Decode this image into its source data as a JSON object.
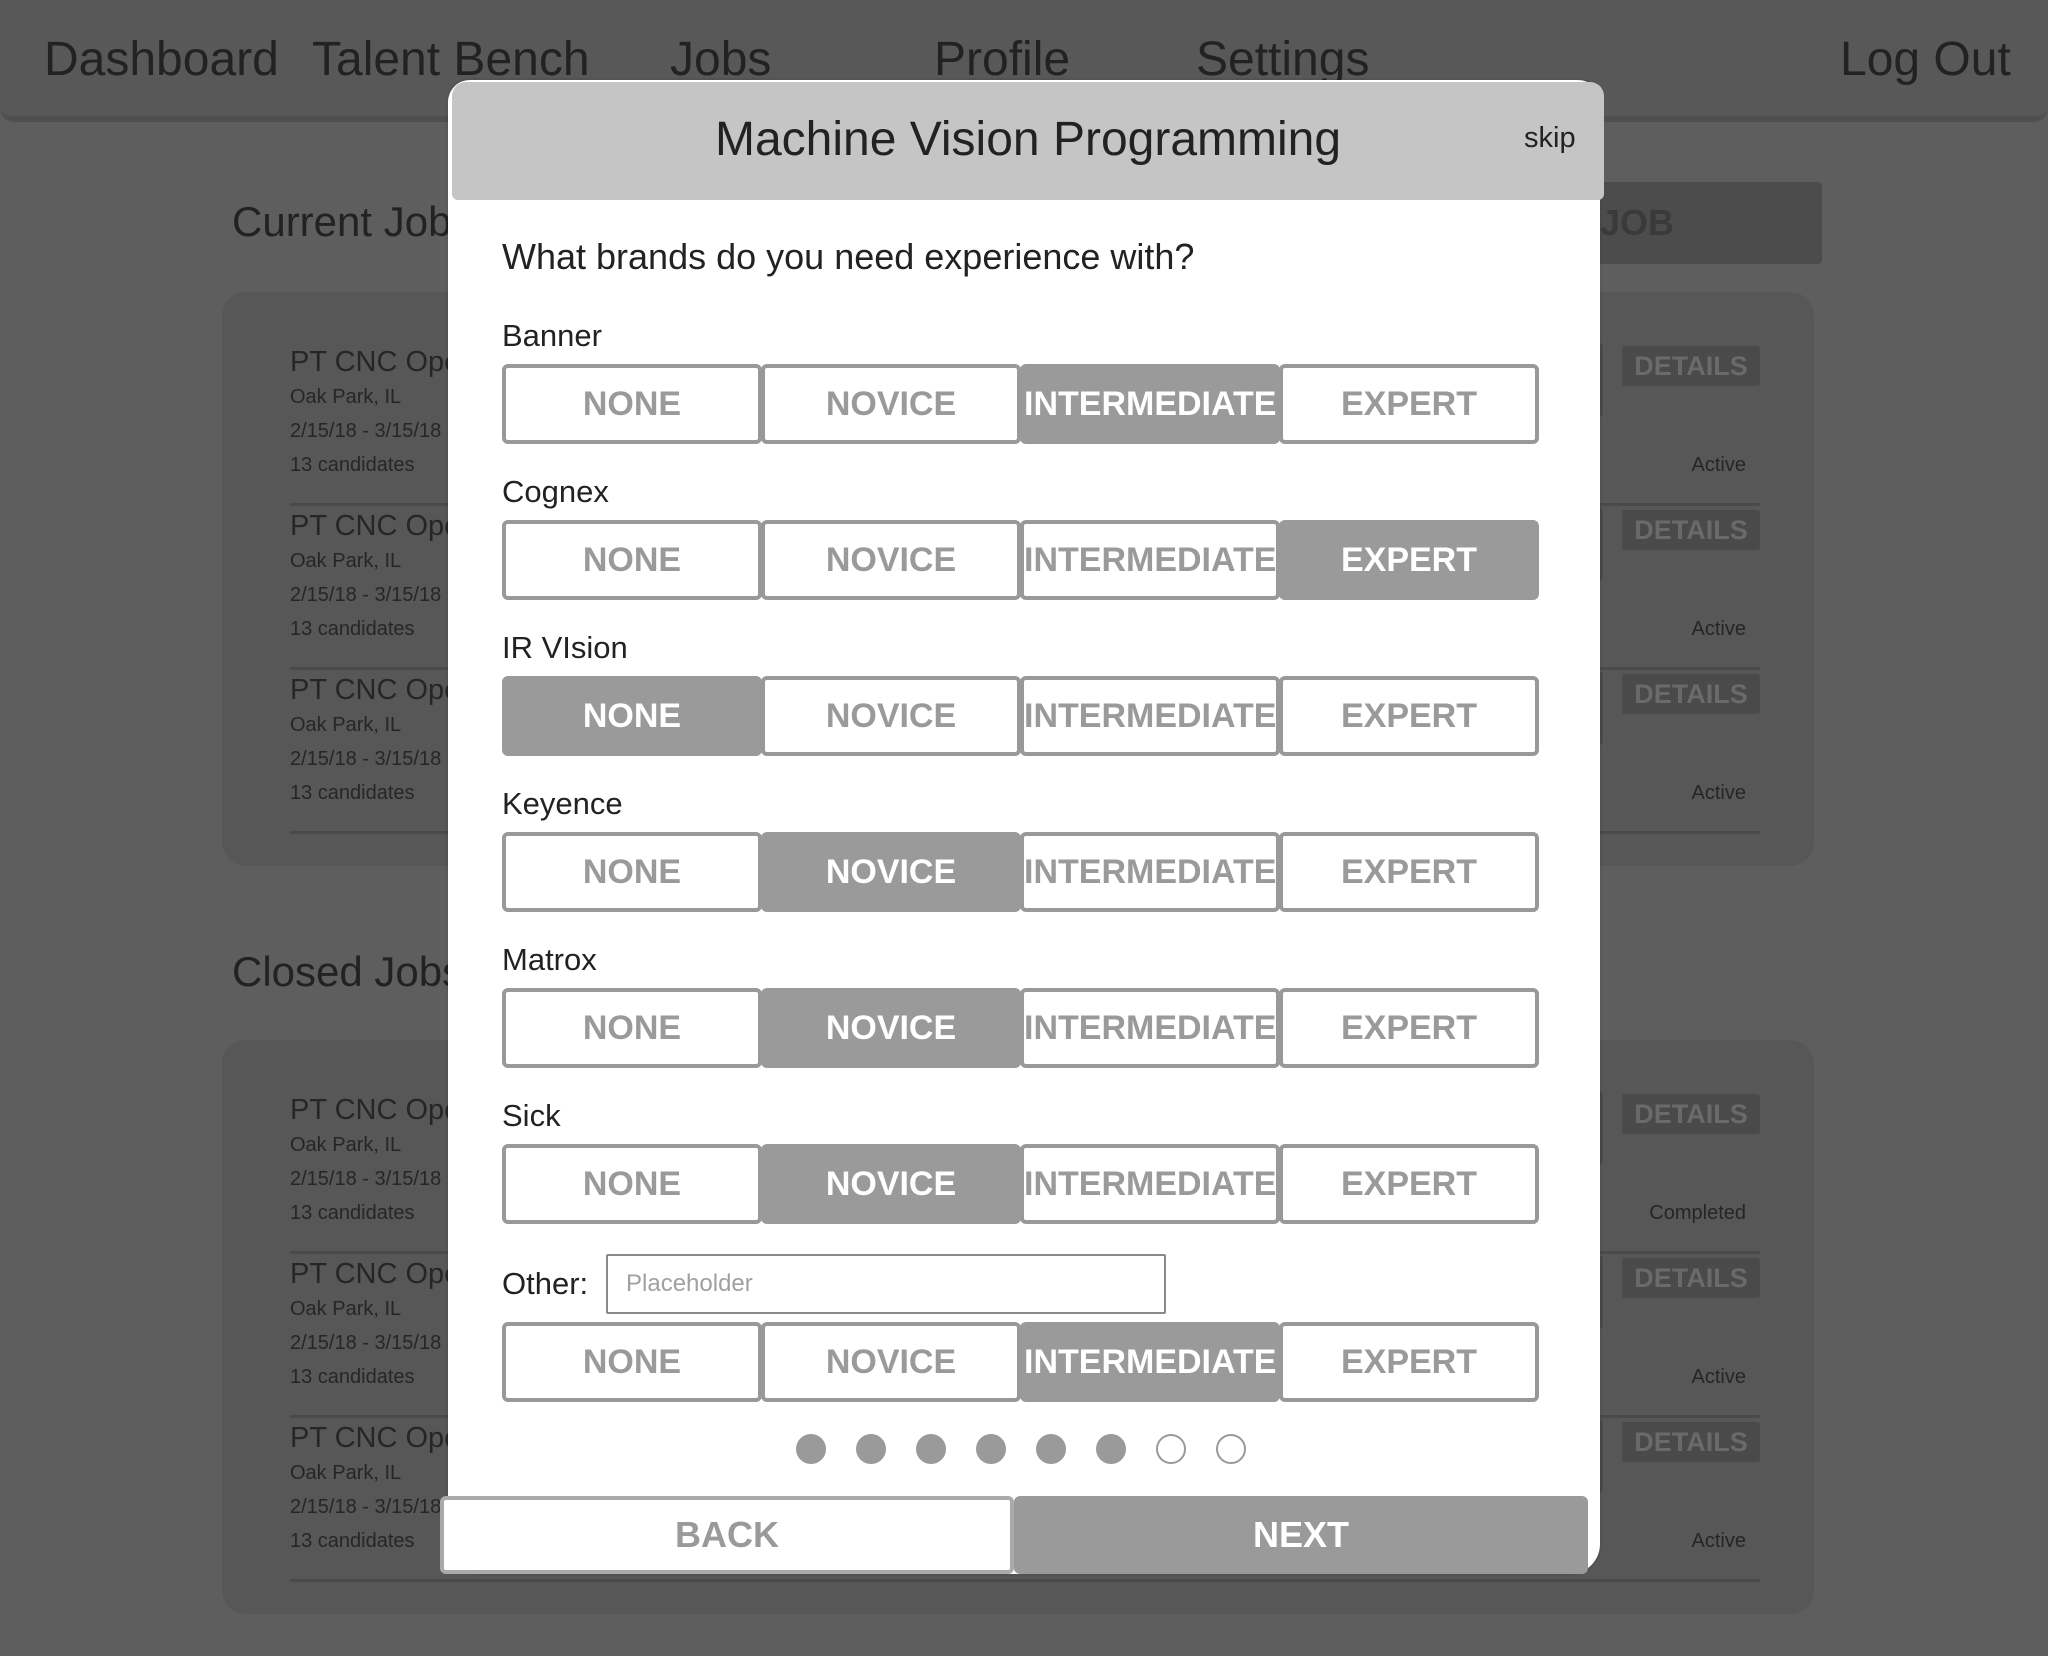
{
  "nav": {
    "dashboard": "Dashboard",
    "talent_bench": "Talent Bench",
    "jobs": "Jobs",
    "profile": "Profile",
    "settings": "Settings",
    "logout": "Log Out"
  },
  "background": {
    "current_jobs_title": "Current Jobs",
    "closed_jobs_title": "Closed Jobs",
    "new_job_label": "JOB",
    "details_label": "DETAILS",
    "current_jobs": [
      {
        "title": "PT CNC Operator",
        "location": "Oak Park, IL",
        "dates": "2/15/18 - 3/15/18",
        "candidates": "13 candidates",
        "status": "Active"
      },
      {
        "title": "PT CNC Operator",
        "location": "Oak Park, IL",
        "dates": "2/15/18 - 3/15/18",
        "candidates": "13 candidates",
        "status": "Active"
      },
      {
        "title": "PT CNC Operator",
        "location": "Oak Park, IL",
        "dates": "2/15/18 - 3/15/18",
        "candidates": "13 candidates",
        "status": "Active"
      }
    ],
    "closed_jobs": [
      {
        "title": "PT CNC Operator",
        "location": "Oak Park, IL",
        "dates": "2/15/18 - 3/15/18",
        "candidates": "13 candidates",
        "status": "Completed"
      },
      {
        "title": "PT CNC Operator",
        "location": "Oak Park, IL",
        "dates": "2/15/18 - 3/15/18",
        "candidates": "13 candidates",
        "status": "Active"
      },
      {
        "title": "PT CNC Operator",
        "location": "Oak Park, IL",
        "dates": "2/15/18 - 3/15/18",
        "candidates": "13 candidates",
        "status": "Active"
      }
    ]
  },
  "modal": {
    "title": "Machine Vision Programming",
    "skip": "skip",
    "question": "What brands do you need experience with?",
    "levels": [
      "NONE",
      "NOVICE",
      "INTERMEDIATE",
      "EXPERT"
    ],
    "brands": [
      {
        "name": "Banner",
        "selected": "INTERMEDIATE"
      },
      {
        "name": "Cognex",
        "selected": "EXPERT"
      },
      {
        "name": "IR VIsion",
        "selected": "NONE"
      },
      {
        "name": "Keyence",
        "selected": "NOVICE"
      },
      {
        "name": "Matrox",
        "selected": "NOVICE"
      },
      {
        "name": "Sick",
        "selected": "NOVICE"
      }
    ],
    "other": {
      "label": "Other:",
      "placeholder": "Placeholder",
      "value": "",
      "selected": "INTERMEDIATE"
    },
    "progress": {
      "total_steps": 8,
      "completed_steps": 6
    },
    "back_label": "BACK",
    "next_label": "NEXT"
  },
  "colors": {
    "overlay": "#5e5e5e",
    "selected_segment": "#9a9a9a",
    "header": "#c5c5c5"
  }
}
